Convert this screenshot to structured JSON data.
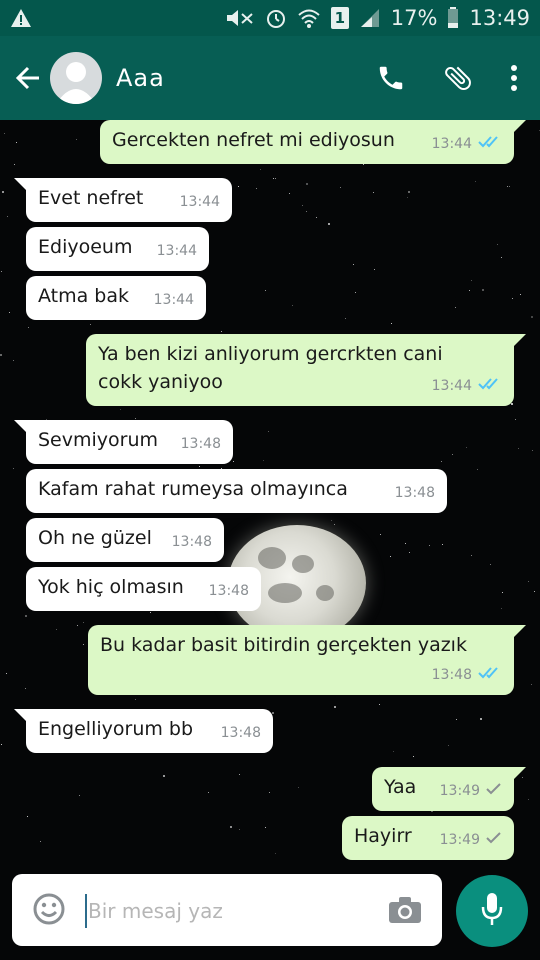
{
  "status_bar": {
    "battery": "17%",
    "time": "13:49",
    "sim_slot": "1"
  },
  "header": {
    "contact_name": "Aaa"
  },
  "messages": [
    {
      "dir": "out",
      "text": "Gercekten nefret mi ediyosun",
      "time": "13:44",
      "ticks": "read"
    },
    {
      "dir": "in",
      "text": "Evet nefret",
      "time": "13:44"
    },
    {
      "dir": "in",
      "text": "Ediyoeum",
      "time": "13:44"
    },
    {
      "dir": "in",
      "text": "Atma bak",
      "time": "13:44"
    },
    {
      "dir": "out",
      "text_line1": "Ya ben kizi anliyorum gercrkten cani",
      "text_line2": "cokk yaniyoo",
      "time": "13:44",
      "ticks": "read"
    },
    {
      "dir": "in",
      "text": "Sevmiyorum",
      "time": "13:48"
    },
    {
      "dir": "in",
      "text": "Kafam rahat rumeysa  olmayınca",
      "time": "13:48"
    },
    {
      "dir": "in",
      "text": "Oh ne güzel",
      "time": "13:48"
    },
    {
      "dir": "in",
      "text": "Yok hiç olmasın",
      "time": "13:48"
    },
    {
      "dir": "out",
      "text": "Bu kadar basit bitirdin gerçekten yazık",
      "time": "13:48",
      "ticks": "read"
    },
    {
      "dir": "in",
      "text": "Engelliyorum bb",
      "time": "13:48"
    },
    {
      "dir": "out",
      "text": "Yaa",
      "time": "13:49",
      "ticks": "sent"
    },
    {
      "dir": "out",
      "text": "Hayirr",
      "time": "13:49",
      "ticks": "sent"
    }
  ],
  "composer": {
    "placeholder": "Bir mesaj yaz"
  },
  "colors": {
    "header": "#075e54",
    "status_bar": "#04574c",
    "outgoing_bubble": "#dcf8c6",
    "incoming_bubble": "#ffffff",
    "read_tick": "#4fc3f7",
    "mic_button": "#0a8f7e"
  },
  "icons": {
    "status_left": "warning-icon",
    "status_right": [
      "mute-icon",
      "alarm-icon",
      "wifi-icon",
      "signal-icon",
      "battery-icon"
    ],
    "header": [
      "back-arrow-icon",
      "avatar-placeholder",
      "phone-icon",
      "attach-icon",
      "more-vert-icon"
    ],
    "composer": [
      "emoji-icon",
      "camera-icon",
      "mic-icon"
    ]
  }
}
